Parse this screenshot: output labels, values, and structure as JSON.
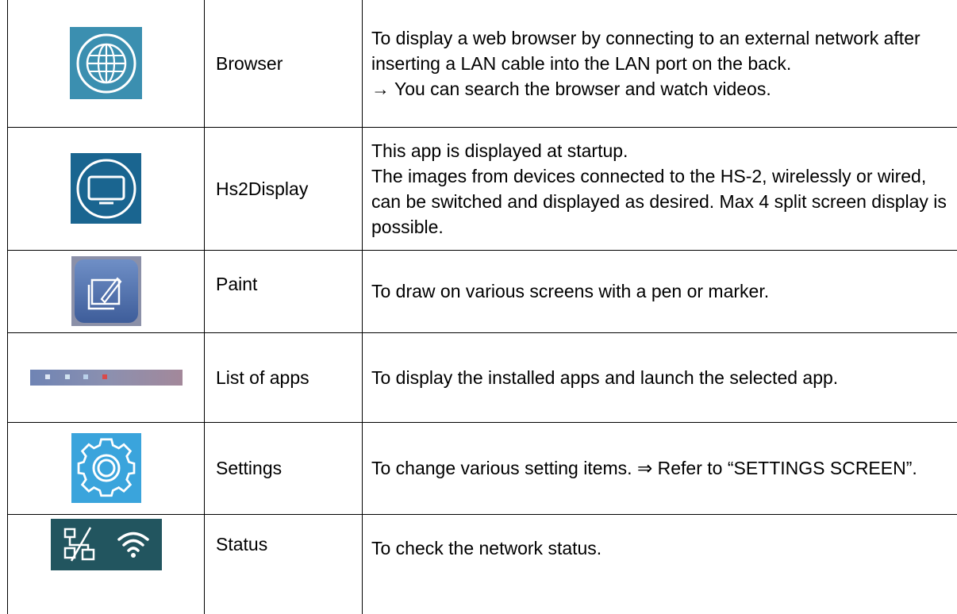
{
  "rows": [
    {
      "icon": "globe-icon",
      "name": "Browser",
      "desc": [
        "To display a web browser by connecting to an external network after inserting a LAN cable into the LAN port on the back.",
        "→ You can search the browser and watch videos."
      ]
    },
    {
      "icon": "monitor-icon",
      "name": "Hs2Display",
      "desc": [
        "This app is displayed at startup.",
        "The images from devices connected to the HS-2, wirelessly or wired, can be switched and displayed as desired. Max 4 split screen display is possible."
      ]
    },
    {
      "icon": "paint-icon",
      "name": "Paint",
      "desc": [
        "To draw on various screens with a pen or marker."
      ]
    },
    {
      "icon": "app-list-bar-icon",
      "name": "List of apps",
      "desc": [
        "To display the installed apps and launch the selected app."
      ]
    },
    {
      "icon": "gear-icon",
      "name": "Settings",
      "desc": [
        "To change various setting items.  ⇒ Refer to “SETTINGS SCREEN”."
      ]
    },
    {
      "icon": "network-status-icon",
      "name": "Status",
      "desc": [
        "To check the network status."
      ]
    }
  ],
  "colors": {
    "browser_bg": "#3b8fb0",
    "display_bg": "#1a6590",
    "paint_bg": "#4a6aa6",
    "settings_bg": "#3aa4dc",
    "status_bg": "#22555f"
  }
}
